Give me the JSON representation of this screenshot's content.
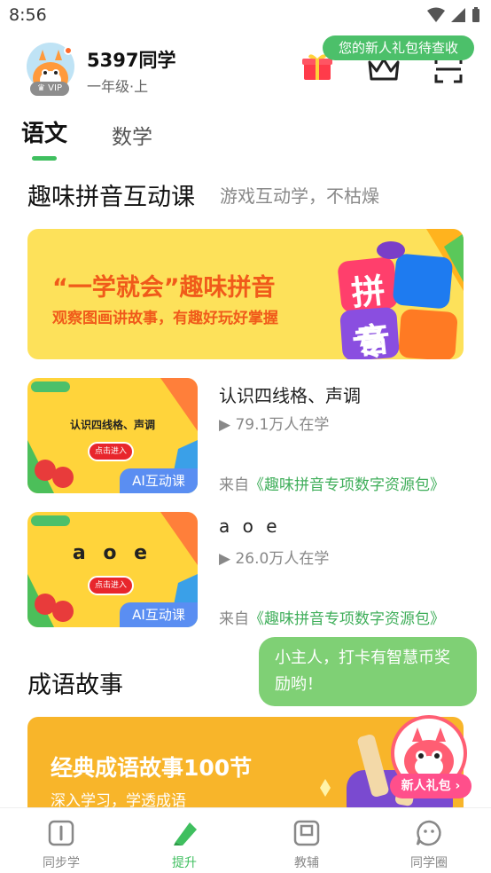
{
  "status_bar": {
    "time": "8:56"
  },
  "header": {
    "user_name": "5397同学",
    "grade": "一年级·上",
    "vip_label": "VIP",
    "gift_tooltip": "您的新人礼包待查收"
  },
  "tabs": [
    {
      "label": "语文",
      "active": true
    },
    {
      "label": "数学",
      "active": false
    }
  ],
  "section_pinyin": {
    "title": "趣味拼音互动课",
    "subtitle": "游戏互动学，不枯燥",
    "banner": {
      "headline": "“一学就会”趣味拼音",
      "subline": "观察图画讲故事，有趣好玩好掌握",
      "logo_line1": "拼音",
      "logo_line2": "专项"
    },
    "courses": [
      {
        "title": "认识四线格、声调",
        "learners": "79.1万人在学",
        "source_prefix": "来自",
        "source_name": "《趣味拼音专项数字资源包》",
        "thumb_text": "认识四线格、声调",
        "thumb_button": "点击进入",
        "tag": "AI互动课"
      },
      {
        "title": "a o e",
        "learners": "26.0万人在学",
        "source_prefix": "来自",
        "source_name": "《趣味拼音专项数字资源包》",
        "thumb_text": "a o e",
        "thumb_button": "点击进入",
        "tag": "AI互动课"
      }
    ]
  },
  "section_idiom": {
    "title": "成语故事",
    "banner": {
      "headline": "经典成语故事100节",
      "subline": "深入学习，学透成语"
    }
  },
  "mascot": {
    "bubble_text": "小主人，打卡有智慧币奖励哟！",
    "newbie_label": "新人礼包 ›"
  },
  "bottom_nav": [
    {
      "label": "同步学",
      "icon": "book-icon",
      "active": false
    },
    {
      "label": "提升",
      "icon": "pencil-eraser-icon",
      "active": true
    },
    {
      "label": "教辅",
      "icon": "workbook-icon",
      "active": false
    },
    {
      "label": "同学圈",
      "icon": "chat-face-icon",
      "active": false
    }
  ],
  "colors": {
    "brand_green": "#3fbf5f",
    "banner_yellow": "#fde15a",
    "banner_orange": "#f8b52a",
    "ai_tag_blue": "#5a8ef2"
  }
}
